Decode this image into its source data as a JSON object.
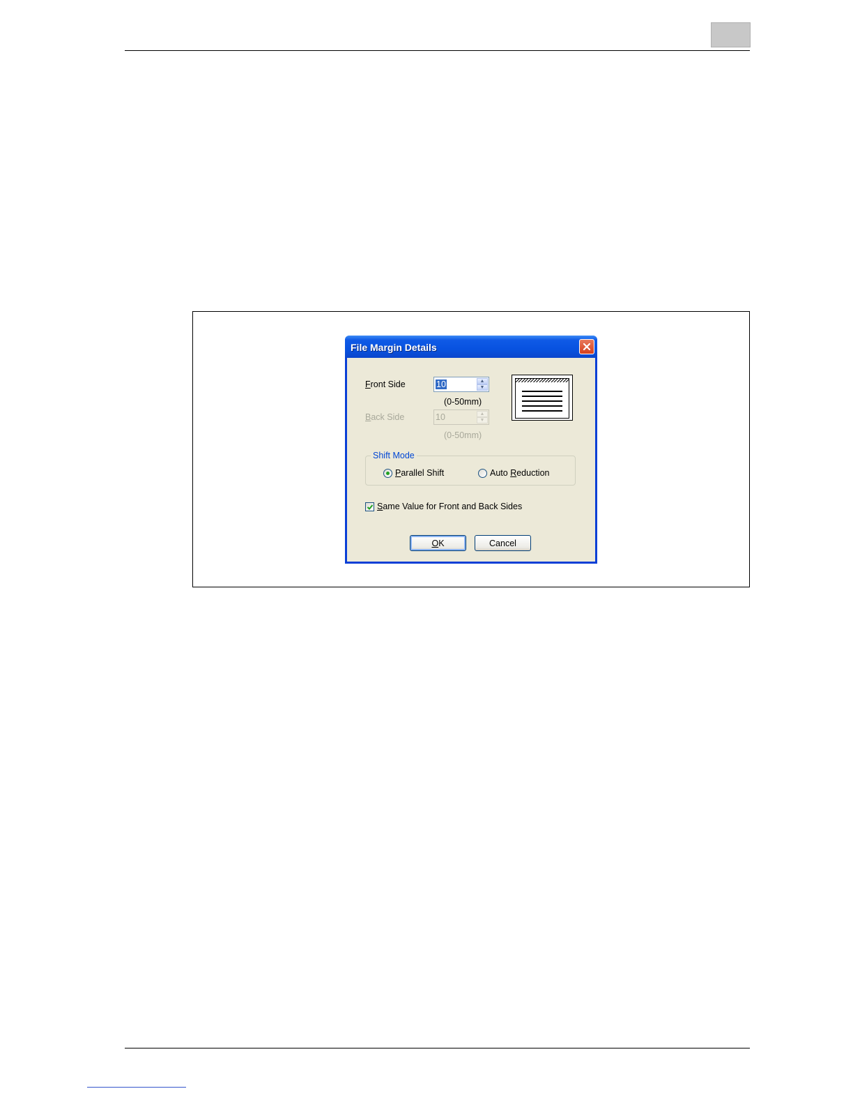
{
  "dialog": {
    "title": "File Margin Details",
    "front_side": {
      "label_accel": "F",
      "label_rest": "ront Side",
      "value": "10",
      "range": "(0-50mm)",
      "enabled": true
    },
    "back_side": {
      "label_accel": "B",
      "label_rest": "ack Side",
      "value": "10",
      "range": "(0-50mm)",
      "enabled": false
    },
    "shift_mode": {
      "legend": "Shift Mode",
      "parallel_accel": "P",
      "parallel_rest": "arallel Shift",
      "auto_pre": "Auto ",
      "auto_accel": "R",
      "auto_rest": "eduction",
      "selected": "parallel"
    },
    "same_value": {
      "accel": "S",
      "rest": "ame Value for Front and Back Sides",
      "checked": true
    },
    "buttons": {
      "ok_accel": "O",
      "ok_rest": "K",
      "cancel": "Cancel"
    }
  },
  "colors": {
    "title_bar": "#0852e0",
    "dialog_face": "#ece9d8",
    "group_legend": "#0046d5",
    "disabled_text": "#a8a89a",
    "radio_selected": "#21a121",
    "check_mark": "#21a121"
  },
  "icons": [
    "close-icon",
    "spin-up-icon",
    "spin-down-icon",
    "check-icon",
    "page-preview-icon"
  ]
}
